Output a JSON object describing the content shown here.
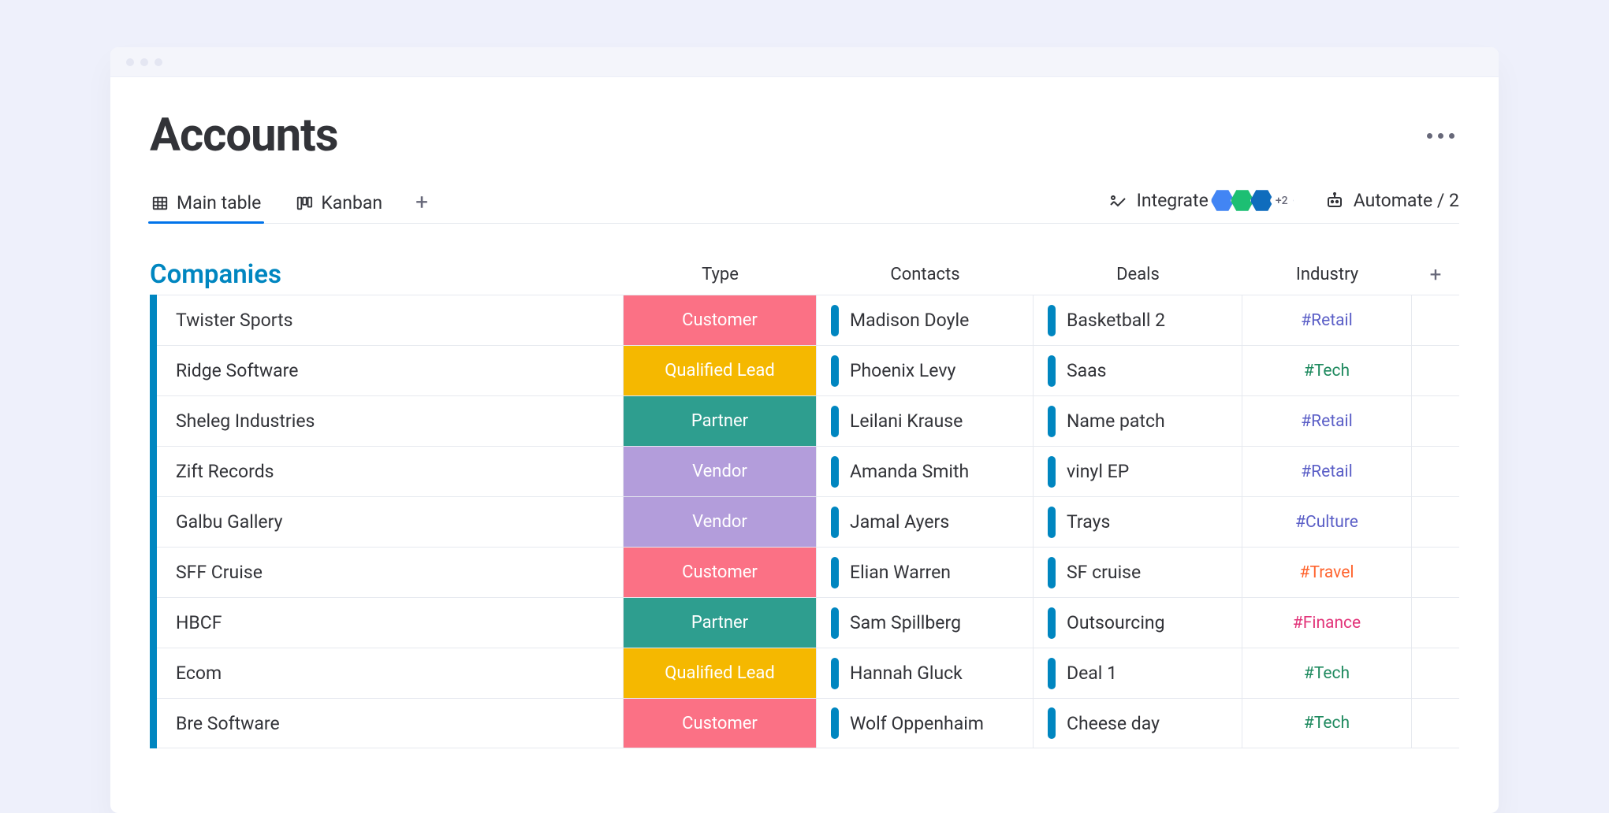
{
  "page": {
    "title": "Accounts"
  },
  "tabs": {
    "main_table": "Main table",
    "kanban": "Kanban"
  },
  "actions": {
    "integrate": "Integrate",
    "automate": "Automate / 2",
    "integrations_extra": "+2"
  },
  "group": {
    "title": "Companies",
    "columns": {
      "type": "Type",
      "contacts": "Contacts",
      "deals": "Deals",
      "industry": "Industry"
    }
  },
  "type_colors": {
    "Customer": "#fb7185",
    "Qualified Lead": "#f5b800",
    "Partner": "#2e9e8f",
    "Vendor": "#b39ddb"
  },
  "industry_colors": {
    "#Retail": "#5b5fc7",
    "#Tech": "#1f8a5f",
    "#Culture": "#5b5fc7",
    "#Travel": "#ff642e",
    "#Finance": "#e2357a"
  },
  "rows": [
    {
      "company": "Twister Sports",
      "type": "Customer",
      "contact": "Madison Doyle",
      "deal": "Basketball 2",
      "industry": "#Retail"
    },
    {
      "company": "Ridge Software",
      "type": "Qualified Lead",
      "contact": "Phoenix Levy",
      "deal": "Saas",
      "industry": "#Tech"
    },
    {
      "company": "Sheleg Industries",
      "type": "Partner",
      "contact": "Leilani Krause",
      "deal": "Name patch",
      "industry": "#Retail"
    },
    {
      "company": "Zift Records",
      "type": "Vendor",
      "contact": "Amanda Smith",
      "deal": "vinyl EP",
      "industry": "#Retail"
    },
    {
      "company": "Galbu Gallery",
      "type": "Vendor",
      "contact": "Jamal Ayers",
      "deal": "Trays",
      "industry": "#Culture"
    },
    {
      "company": "SFF Cruise",
      "type": "Customer",
      "contact": "Elian Warren",
      "deal": "SF cruise",
      "industry": "#Travel"
    },
    {
      "company": "HBCF",
      "type": "Partner",
      "contact": "Sam Spillberg",
      "deal": "Outsourcing",
      "industry": "#Finance"
    },
    {
      "company": "Ecom",
      "type": "Qualified Lead",
      "contact": "Hannah Gluck",
      "deal": "Deal 1",
      "industry": "#Tech"
    },
    {
      "company": "Bre Software",
      "type": "Customer",
      "contact": "Wolf Oppenhaim",
      "deal": "Cheese day",
      "industry": "#Tech"
    }
  ]
}
